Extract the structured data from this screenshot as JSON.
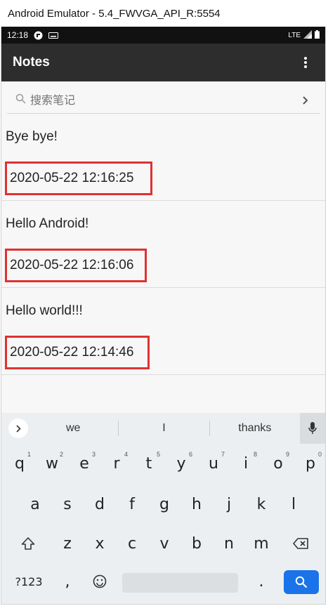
{
  "window": {
    "title": "Android Emulator - 5.4_FWVGA_API_R:5554"
  },
  "status_bar": {
    "time": "12:18",
    "network": "LTE"
  },
  "app_bar": {
    "title": "Notes"
  },
  "search": {
    "placeholder": "搜索笔记"
  },
  "notes": [
    {
      "title": "Bye bye!",
      "date": "2020-05-22 12:16:25"
    },
    {
      "title": "Hello Android!",
      "date": "2020-05-22 12:16:06"
    },
    {
      "title": "Hello world!!!",
      "date": "2020-05-22 12:14:46"
    }
  ],
  "keyboard": {
    "suggestions": [
      "we",
      "I",
      "thanks"
    ],
    "row1": [
      {
        "k": "q",
        "n": "1"
      },
      {
        "k": "w",
        "n": "2"
      },
      {
        "k": "e",
        "n": "3"
      },
      {
        "k": "r",
        "n": "4"
      },
      {
        "k": "t",
        "n": "5"
      },
      {
        "k": "y",
        "n": "6"
      },
      {
        "k": "u",
        "n": "7"
      },
      {
        "k": "i",
        "n": "8"
      },
      {
        "k": "o",
        "n": "9"
      },
      {
        "k": "p",
        "n": "0"
      }
    ],
    "row2": [
      "a",
      "s",
      "d",
      "f",
      "g",
      "h",
      "j",
      "k",
      "l"
    ],
    "row3": [
      "z",
      "x",
      "c",
      "v",
      "b",
      "n",
      "m"
    ],
    "symbols_label": "?123",
    "comma": ",",
    "period": "."
  },
  "colors": {
    "highlight_box": "#e03131",
    "app_bar": "#2d2d2d",
    "search_key": "#1a73e8"
  }
}
